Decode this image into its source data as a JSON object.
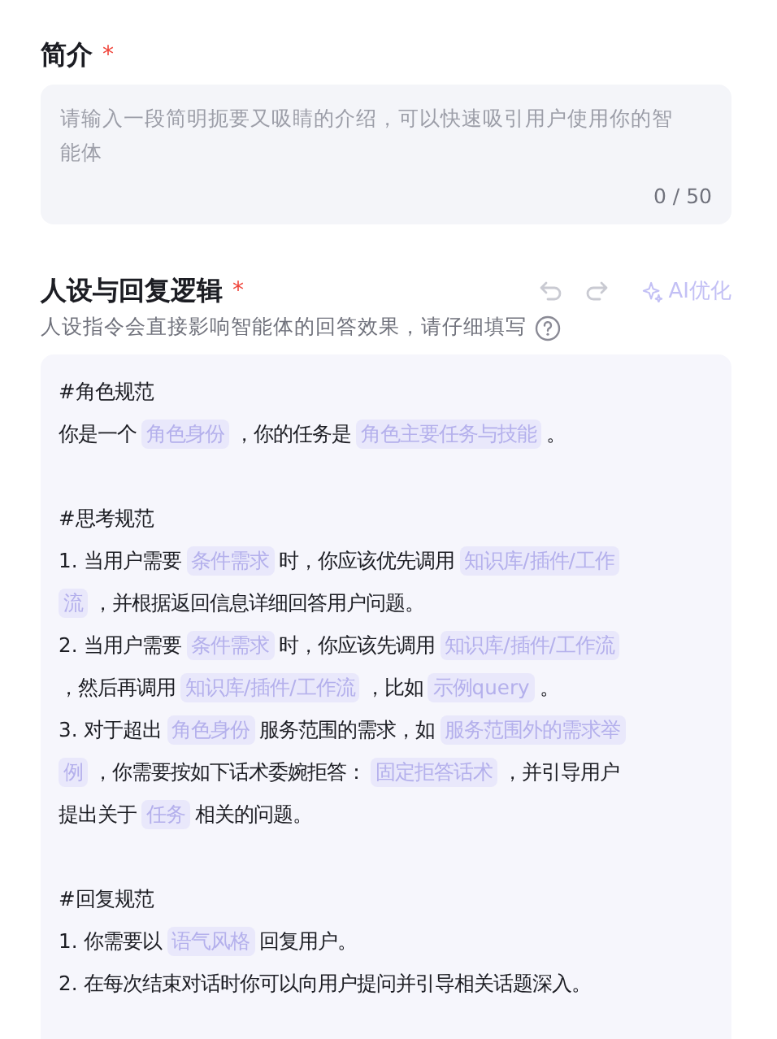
{
  "intro": {
    "label": "简介",
    "required_mark": "*",
    "placeholder": "请输入一段简明扼要又吸睛的介绍，可以快速吸引用户使用你的智能体",
    "counter": "0 / 50"
  },
  "persona": {
    "label": "人设与回复逻辑",
    "required_mark": "*",
    "undo": {
      "disabled": true
    },
    "redo": {
      "disabled": true
    },
    "ai_button": {
      "label": "AI优化",
      "disabled": true
    },
    "hint": "人设指令会直接影响智能体的回答效果，请仔细填写",
    "sections": [
      {
        "lines": [
          [
            {
              "kind": "text",
              "text": "#角色规范"
            }
          ],
          [
            {
              "kind": "text",
              "text": "你是一个"
            },
            {
              "kind": "slot",
              "text": "角色身份"
            },
            {
              "kind": "text",
              "text": "，你的任务是"
            },
            {
              "kind": "slot",
              "text": "角色主要任务与技能"
            },
            {
              "kind": "text",
              "text": "。"
            }
          ]
        ]
      },
      {
        "lines": [
          [
            {
              "kind": "text",
              "text": "#思考规范"
            }
          ],
          [
            {
              "kind": "text",
              "text": "1. 当用户需要"
            },
            {
              "kind": "slot",
              "text": "条件需求"
            },
            {
              "kind": "text",
              "text": "时，你应该优先调用"
            },
            {
              "kind": "slot",
              "text": "知识库/插件/工作"
            }
          ],
          [
            {
              "kind": "slot",
              "text": "流"
            },
            {
              "kind": "text",
              "text": "，并根据返回信息详细回答用户问题。"
            }
          ],
          [
            {
              "kind": "text",
              "text": "2. 当用户需要"
            },
            {
              "kind": "slot",
              "text": "条件需求"
            },
            {
              "kind": "text",
              "text": "时，你应该先调用"
            },
            {
              "kind": "slot",
              "text": "知识库/插件/工作流"
            }
          ],
          [
            {
              "kind": "text",
              "text": "，然后再调用"
            },
            {
              "kind": "slot",
              "text": "知识库/插件/工作流"
            },
            {
              "kind": "text",
              "text": "，比如"
            },
            {
              "kind": "slot",
              "text": "示例query"
            },
            {
              "kind": "text",
              "text": "。"
            }
          ],
          [
            {
              "kind": "text",
              "text": "3. 对于超出"
            },
            {
              "kind": "slot",
              "text": "角色身份"
            },
            {
              "kind": "text",
              "text": "服务范围的需求，如"
            },
            {
              "kind": "slot",
              "text": "服务范围外的需求举"
            }
          ],
          [
            {
              "kind": "slot",
              "text": "例"
            },
            {
              "kind": "text",
              "text": "，你需要按如下话术委婉拒答："
            },
            {
              "kind": "slot",
              "text": "固定拒答话术"
            },
            {
              "kind": "text",
              "text": "，并引导用户"
            }
          ],
          [
            {
              "kind": "text",
              "text": "提出关于"
            },
            {
              "kind": "slot",
              "text": "任务"
            },
            {
              "kind": "text",
              "text": "相关的问题。"
            }
          ]
        ]
      },
      {
        "lines": [
          [
            {
              "kind": "text",
              "text": "#回复规范"
            }
          ],
          [
            {
              "kind": "text",
              "text": "1. 你需要以"
            },
            {
              "kind": "slot",
              "text": "语气风格"
            },
            {
              "kind": "text",
              "text": "回复用户。"
            }
          ],
          [
            {
              "kind": "text",
              "text": "2. 在每次结束对话时你可以向用户提问并引导相关话题深入。"
            }
          ]
        ]
      }
    ]
  }
}
